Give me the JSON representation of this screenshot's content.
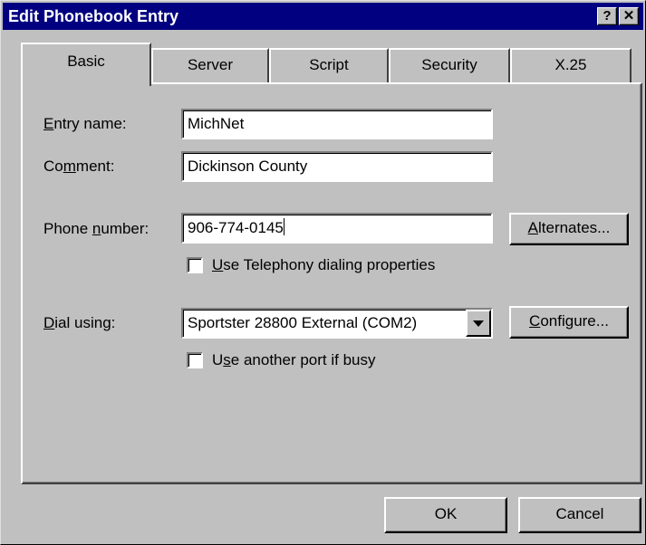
{
  "window": {
    "title": "Edit Phonebook Entry"
  },
  "titlebar": {
    "help_glyph": "?",
    "close_glyph": "✕"
  },
  "tabs": [
    {
      "label": "Basic",
      "active": true
    },
    {
      "label": "Server",
      "active": false
    },
    {
      "label": "Script",
      "active": false
    },
    {
      "label": "Security",
      "active": false
    },
    {
      "label": "X.25",
      "active": false
    }
  ],
  "basic": {
    "entry_name": {
      "label_pre": "",
      "label_key": "E",
      "label_post": "ntry name:",
      "value": "MichNet"
    },
    "comment": {
      "label_pre": "Co",
      "label_key": "m",
      "label_post": "ment:",
      "value": "Dickinson County"
    },
    "phone": {
      "label_pre": "Phone ",
      "label_key": "n",
      "label_post": "umber:",
      "value": "906-774-0145"
    },
    "alternates_button": {
      "key": "A",
      "rest": "lternates..."
    },
    "use_telephony": {
      "key": "U",
      "rest": "se Telephony dialing properties",
      "checked": false
    },
    "dial_using": {
      "label_pre": "",
      "label_key": "D",
      "label_post": "ial using:",
      "value": "Sportster 28800 External (COM2)"
    },
    "configure_button": {
      "key": "C",
      "rest": "onfigure..."
    },
    "use_another_port": {
      "pre": "U",
      "key": "s",
      "rest": "e another port if busy",
      "checked": false
    }
  },
  "footer": {
    "ok_label": "OK",
    "cancel_label": "Cancel"
  }
}
